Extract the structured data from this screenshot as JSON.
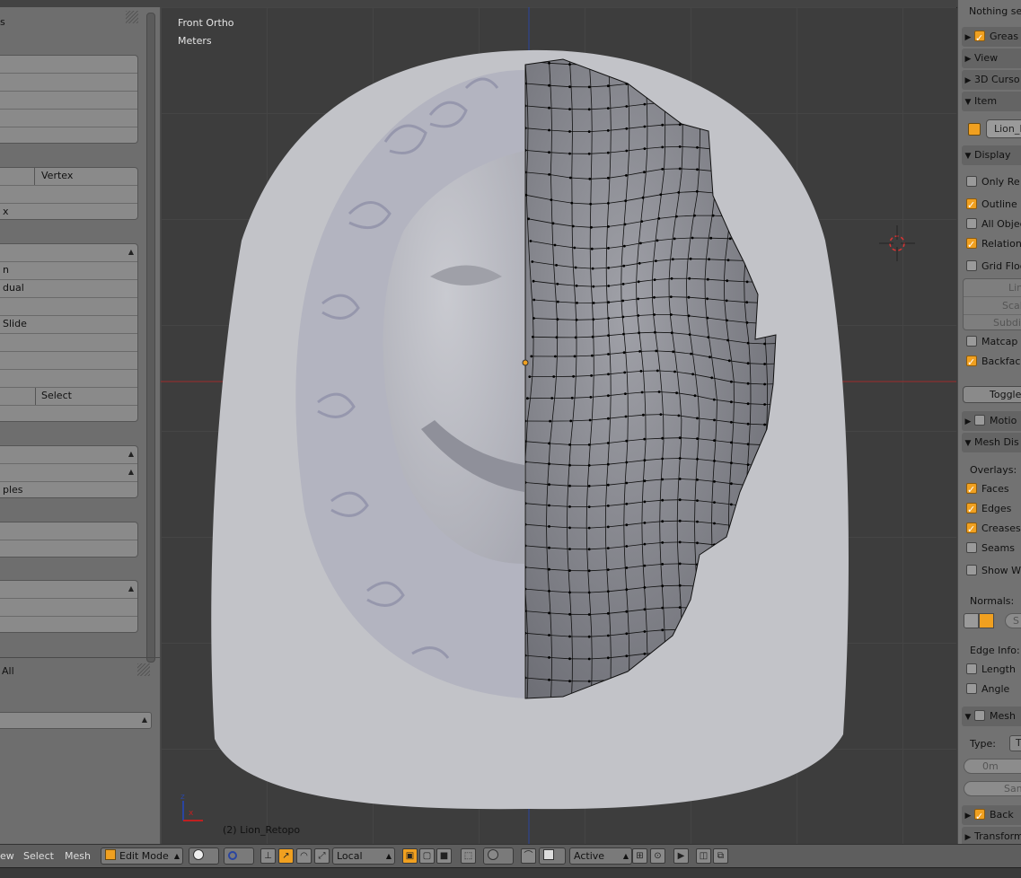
{
  "viewport": {
    "view_label": "Front Ortho",
    "units_label": "Meters",
    "object_label": "(2) Lion_Retopo"
  },
  "tool_shelf": {
    "snap_vertex": "Vertex",
    "vertex_tail": "x",
    "row_n": "n",
    "row_dual": "dual",
    "row_slide": "Slide",
    "select_label": "Select",
    "row_ples": "ples",
    "all_label": "All"
  },
  "properties": {
    "nothing_selected": "Nothing sel",
    "grease": "Greas",
    "view": "View",
    "cursor": "3D Curso",
    "item": "Item",
    "item_name": "Lion_R",
    "display": "Display",
    "only_render": "Only Re",
    "outline": "Outline S",
    "all_objects": "All Objec",
    "relationship": "Relation",
    "grid_floor": "Grid Floo",
    "lines": "Lin",
    "scale": "Scale",
    "subdiv": "Subdiv",
    "matcap": "Matcap",
    "backface": "Backfac",
    "toggle": "Toggle",
    "motion": "Motio",
    "mesh_display": "Mesh Dis",
    "overlays": "Overlays:",
    "faces": "Faces",
    "edges": "Edges",
    "creases": "Creases",
    "seams": "Seams",
    "show_w": "Show W",
    "normals": "Normals:",
    "normals_size": "S",
    "edge_info": "Edge Info:",
    "length": "Length",
    "angle": "Angle",
    "mesh_analysis": "Mesh",
    "type_label": "Type:",
    "type_value": "T",
    "zero_m": "0m",
    "samples": "Sam",
    "background": "Back",
    "transform": "Transform"
  },
  "bottom_bar": {
    "view_menu": "ew",
    "select_menu": "Select",
    "mesh_menu": "Mesh",
    "mode": "Edit Mode",
    "orientation": "Local",
    "pivot": "Active"
  },
  "colors": {
    "accent_orange": "#f0a020",
    "viewport_bg": "#3d3d3d",
    "wire": "#111111"
  }
}
